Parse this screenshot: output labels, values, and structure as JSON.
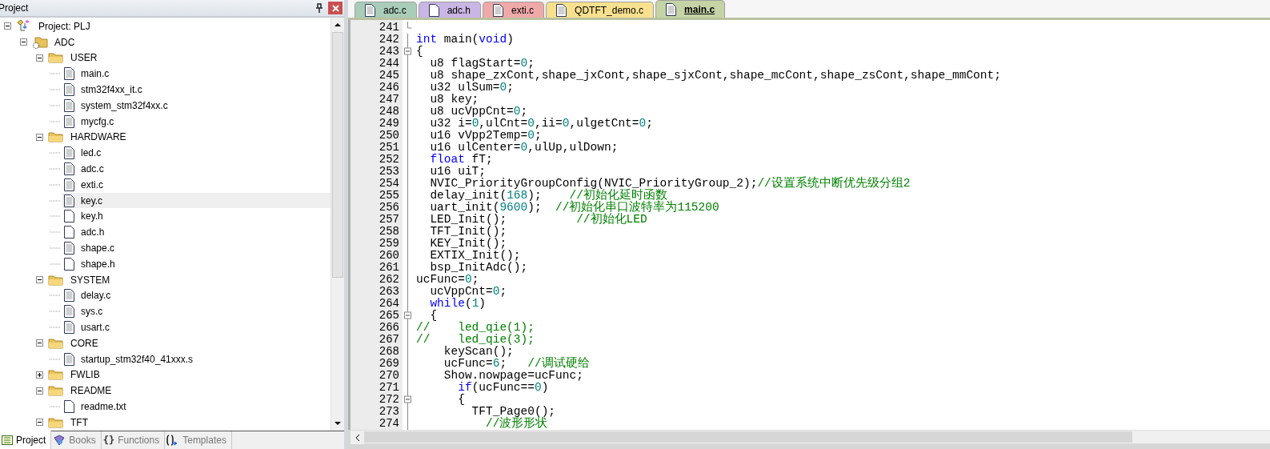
{
  "project_panel": {
    "title": "Project",
    "tree": [
      {
        "label": "Project: PLJ",
        "kind": "project",
        "expanded": true,
        "selected": false,
        "children": [
          {
            "label": "ADC",
            "kind": "target",
            "expanded": true,
            "selected": false,
            "children": [
              {
                "label": "USER",
                "kind": "folder",
                "expanded": true,
                "selected": false,
                "children": [
                  {
                    "label": "main.c",
                    "kind": "source",
                    "selected": false
                  },
                  {
                    "label": "stm32f4xx_it.c",
                    "kind": "source",
                    "selected": false
                  },
                  {
                    "label": "system_stm32f4xx.c",
                    "kind": "source",
                    "selected": false
                  },
                  {
                    "label": "mycfg.c",
                    "kind": "source",
                    "selected": false
                  }
                ]
              },
              {
                "label": "HARDWARE",
                "kind": "folder",
                "expanded": true,
                "selected": false,
                "children": [
                  {
                    "label": "led.c",
                    "kind": "source",
                    "selected": false
                  },
                  {
                    "label": "adc.c",
                    "kind": "source",
                    "selected": false
                  },
                  {
                    "label": "exti.c",
                    "kind": "source",
                    "selected": false
                  },
                  {
                    "label": "key.c",
                    "kind": "source",
                    "selected": true
                  },
                  {
                    "label": "key.h",
                    "kind": "header",
                    "selected": false
                  },
                  {
                    "label": "adc.h",
                    "kind": "header",
                    "selected": false
                  },
                  {
                    "label": "shape.c",
                    "kind": "source",
                    "selected": false
                  },
                  {
                    "label": "shape.h",
                    "kind": "header",
                    "selected": false
                  }
                ]
              },
              {
                "label": "SYSTEM",
                "kind": "folder",
                "expanded": true,
                "selected": false,
                "children": [
                  {
                    "label": "delay.c",
                    "kind": "source",
                    "selected": false
                  },
                  {
                    "label": "sys.c",
                    "kind": "source",
                    "selected": false
                  },
                  {
                    "label": "usart.c",
                    "kind": "source",
                    "selected": false
                  }
                ]
              },
              {
                "label": "CORE",
                "kind": "folder",
                "expanded": true,
                "selected": false,
                "children": [
                  {
                    "label": "startup_stm32f40_41xxx.s",
                    "kind": "source",
                    "selected": false
                  }
                ]
              },
              {
                "label": "FWLIB",
                "kind": "folder",
                "expanded": false,
                "selected": false
              },
              {
                "label": "README",
                "kind": "folder",
                "expanded": true,
                "selected": false,
                "children": [
                  {
                    "label": "readme.txt",
                    "kind": "header",
                    "selected": false
                  }
                ]
              },
              {
                "label": "TFT",
                "kind": "folder",
                "expanded": true,
                "selected": false
              }
            ]
          }
        ]
      }
    ],
    "bottom_tabs": [
      {
        "label": "Project",
        "kind": "project",
        "selected": true
      },
      {
        "label": "Books",
        "kind": "books",
        "selected": false
      },
      {
        "label": "Functions",
        "kind": "functions",
        "glyph": "{}",
        "selected": false
      },
      {
        "label": "Templates",
        "kind": "templates",
        "selected": false
      }
    ]
  },
  "editor": {
    "tabs": [
      {
        "label": "adc.c",
        "color": "#a9cdb9",
        "selected": false
      },
      {
        "label": "adc.h",
        "color": "#c9b6e4",
        "selected": false
      },
      {
        "label": "exti.c",
        "color": "#f0a9a9",
        "selected": false
      },
      {
        "label": "QDTFT_demo.c",
        "color": "#f8e08e",
        "selected": false
      },
      {
        "label": "main.c",
        "color": "#c5d3a5",
        "selected": true
      }
    ],
    "lines": [
      {
        "number": "241",
        "kind": "closer"
      },
      {
        "number": "242",
        "kind": "plain",
        "tokens": [
          {
            "kind": "keyword",
            "text": "int"
          },
          {
            "kind": "plain",
            "text": " main("
          },
          {
            "kind": "keyword",
            "text": "void"
          },
          {
            "kind": "plain",
            "text": ")"
          }
        ]
      },
      {
        "number": "243",
        "kind": "opener",
        "tokens": [
          {
            "kind": "plain",
            "text": "{"
          }
        ]
      },
      {
        "number": "244",
        "kind": "plain",
        "tokens": [
          {
            "kind": "plain",
            "text": "  u8 flagStart="
          },
          {
            "kind": "number",
            "text": "0"
          },
          {
            "kind": "plain",
            "text": ";"
          }
        ]
      },
      {
        "number": "245",
        "kind": "plain",
        "tokens": [
          {
            "kind": "plain",
            "text": "  u8 shape_zxCont,shape_jxCont,shape_sjxCont,shape_mcCont,shape_zsCont,shape_mmCont;"
          }
        ]
      },
      {
        "number": "246",
        "kind": "plain",
        "tokens": [
          {
            "kind": "plain",
            "text": "  u32 ulSum="
          },
          {
            "kind": "number",
            "text": "0"
          },
          {
            "kind": "plain",
            "text": ";"
          }
        ]
      },
      {
        "number": "247",
        "kind": "plain",
        "tokens": [
          {
            "kind": "plain",
            "text": "  u8 key;"
          }
        ]
      },
      {
        "number": "248",
        "kind": "plain",
        "tokens": [
          {
            "kind": "plain",
            "text": "  u8 ucVppCnt="
          },
          {
            "kind": "number",
            "text": "0"
          },
          {
            "kind": "plain",
            "text": ";"
          }
        ]
      },
      {
        "number": "249",
        "kind": "plain",
        "tokens": [
          {
            "kind": "plain",
            "text": "  u32 i="
          },
          {
            "kind": "number",
            "text": "0"
          },
          {
            "kind": "plain",
            "text": ",ulCnt="
          },
          {
            "kind": "number",
            "text": "0"
          },
          {
            "kind": "plain",
            "text": ",ii="
          },
          {
            "kind": "number",
            "text": "0"
          },
          {
            "kind": "plain",
            "text": ",ulgetCnt="
          },
          {
            "kind": "number",
            "text": "0"
          },
          {
            "kind": "plain",
            "text": ";"
          }
        ]
      },
      {
        "number": "250",
        "kind": "plain",
        "tokens": [
          {
            "kind": "plain",
            "text": "  u16 vVpp2Temp="
          },
          {
            "kind": "number",
            "text": "0"
          },
          {
            "kind": "plain",
            "text": ";"
          }
        ]
      },
      {
        "number": "251",
        "kind": "plain",
        "tokens": [
          {
            "kind": "plain",
            "text": "  u16 ulCenter="
          },
          {
            "kind": "number",
            "text": "0"
          },
          {
            "kind": "plain",
            "text": ",ulUp,ulDown;"
          }
        ]
      },
      {
        "number": "252",
        "kind": "plain",
        "tokens": [
          {
            "kind": "keyword",
            "text": "  float"
          },
          {
            "kind": "plain",
            "text": " fT;"
          }
        ]
      },
      {
        "number": "253",
        "kind": "plain",
        "tokens": [
          {
            "kind": "plain",
            "text": "  u16 uiT;"
          }
        ]
      },
      {
        "number": "254",
        "kind": "plain",
        "tokens": [
          {
            "kind": "plain",
            "text": "  NVIC_PriorityGroupConfig(NVIC_PriorityGroup_2);"
          },
          {
            "kind": "comment",
            "text": "//设置系统中断优先级分组2"
          }
        ]
      },
      {
        "number": "255",
        "kind": "plain",
        "tokens": [
          {
            "kind": "plain",
            "text": "  delay_init("
          },
          {
            "kind": "number",
            "text": "168"
          },
          {
            "kind": "plain",
            "text": ");    "
          },
          {
            "kind": "comment",
            "text": "//初始化延时函数"
          }
        ]
      },
      {
        "number": "256",
        "kind": "plain",
        "tokens": [
          {
            "kind": "plain",
            "text": "  uart_init("
          },
          {
            "kind": "number",
            "text": "9600"
          },
          {
            "kind": "plain",
            "text": ");  "
          },
          {
            "kind": "comment",
            "text": "//初始化串口波特率为115200"
          }
        ]
      },
      {
        "number": "257",
        "kind": "plain",
        "tokens": [
          {
            "kind": "plain",
            "text": "  LED_Init();          "
          },
          {
            "kind": "comment",
            "text": "//初始化LED"
          }
        ]
      },
      {
        "number": "258",
        "kind": "plain",
        "tokens": [
          {
            "kind": "plain",
            "text": "  TFT_Init();"
          }
        ]
      },
      {
        "number": "259",
        "kind": "plain",
        "tokens": [
          {
            "kind": "plain",
            "text": "  KEY_Init();"
          }
        ]
      },
      {
        "number": "260",
        "kind": "plain",
        "tokens": [
          {
            "kind": "plain",
            "text": "  EXTIX_Init();"
          }
        ]
      },
      {
        "number": "261",
        "kind": "plain",
        "tokens": [
          {
            "kind": "plain",
            "text": "  bsp_InitAdc();"
          }
        ]
      },
      {
        "number": "262",
        "kind": "plain",
        "tokens": [
          {
            "kind": "plain",
            "text": "ucFunc="
          },
          {
            "kind": "number",
            "text": "0"
          },
          {
            "kind": "plain",
            "text": ";"
          }
        ]
      },
      {
        "number": "263",
        "kind": "plain",
        "tokens": [
          {
            "kind": "plain",
            "text": "  ucVppCnt="
          },
          {
            "kind": "number",
            "text": "0"
          },
          {
            "kind": "plain",
            "text": ";"
          }
        ]
      },
      {
        "number": "264",
        "kind": "plain",
        "tokens": [
          {
            "kind": "keyword",
            "text": "  while"
          },
          {
            "kind": "plain",
            "text": "("
          },
          {
            "kind": "number",
            "text": "1"
          },
          {
            "kind": "plain",
            "text": ")"
          }
        ]
      },
      {
        "number": "265",
        "kind": "opener",
        "tokens": [
          {
            "kind": "plain",
            "text": "  {"
          }
        ]
      },
      {
        "number": "266",
        "kind": "plain",
        "tokens": [
          {
            "kind": "comment",
            "text": "//    led_qie(1);"
          }
        ]
      },
      {
        "number": "267",
        "kind": "plain",
        "tokens": [
          {
            "kind": "comment",
            "text": "//    led_qie(3);"
          }
        ]
      },
      {
        "number": "268",
        "kind": "plain",
        "tokens": [
          {
            "kind": "plain",
            "text": "    keyScan();"
          }
        ]
      },
      {
        "number": "269",
        "kind": "plain",
        "tokens": [
          {
            "kind": "plain",
            "text": "    ucFunc="
          },
          {
            "kind": "number",
            "text": "6"
          },
          {
            "kind": "plain",
            "text": ";   "
          },
          {
            "kind": "comment",
            "text": "//调试硬给"
          }
        ]
      },
      {
        "number": "270",
        "kind": "plain",
        "tokens": [
          {
            "kind": "plain",
            "text": "    Show.nowpage=ucFunc;"
          }
        ]
      },
      {
        "number": "271",
        "kind": "plain",
        "tokens": [
          {
            "kind": "keyword",
            "text": "      if"
          },
          {
            "kind": "plain",
            "text": "(ucFunc=="
          },
          {
            "kind": "number",
            "text": "0"
          },
          {
            "kind": "plain",
            "text": ")"
          }
        ]
      },
      {
        "number": "272",
        "kind": "opener",
        "tokens": [
          {
            "kind": "plain",
            "text": "      {"
          }
        ]
      },
      {
        "number": "273",
        "kind": "plain",
        "tokens": [
          {
            "kind": "plain",
            "text": "        TFT_Page0();"
          }
        ]
      },
      {
        "number": "274",
        "kind": "plain",
        "tokens": [
          {
            "kind": "comment",
            "text": "          //波形形状"
          }
        ]
      }
    ]
  }
}
